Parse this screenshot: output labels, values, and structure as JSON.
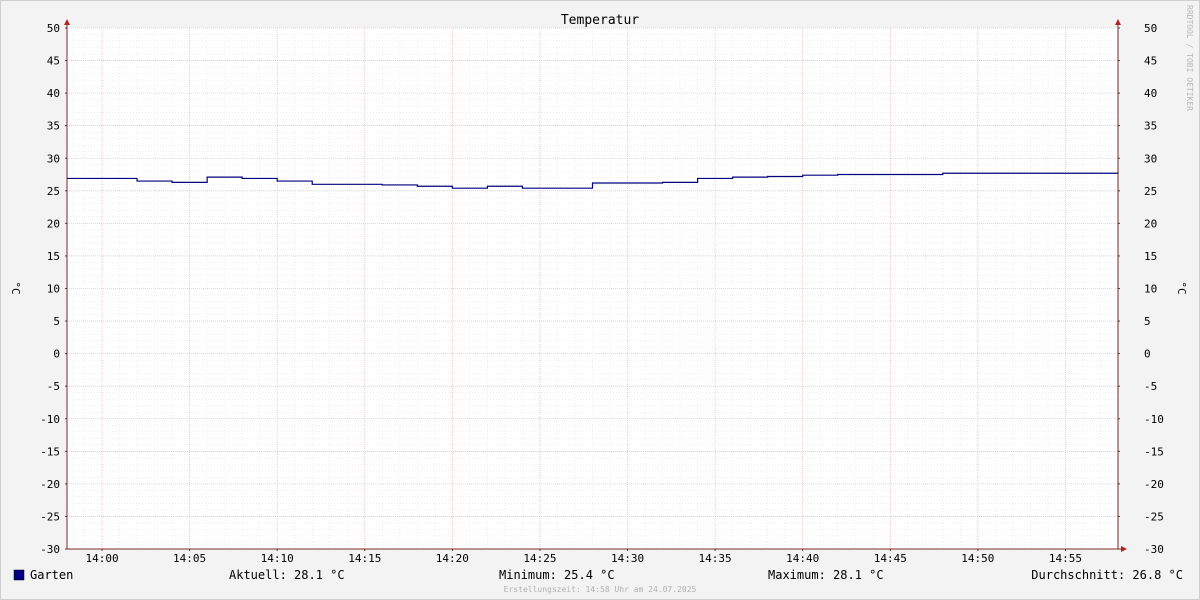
{
  "chart_data": {
    "type": "line",
    "title": "Temperatur",
    "ylabel": "°C",
    "ylabel_right": "°C",
    "ylim": [
      -30,
      50
    ],
    "xlim": [
      "13:58",
      "14:58"
    ],
    "grid": true,
    "y_ticks": [
      50,
      45,
      40,
      35,
      30,
      25,
      20,
      15,
      10,
      5,
      0,
      -5,
      -10,
      -15,
      -20,
      -25,
      -30
    ],
    "x_ticks": [
      "14:00",
      "14:05",
      "14:10",
      "14:15",
      "14:20",
      "14:25",
      "14:30",
      "14:35",
      "14:40",
      "14:45",
      "14:50",
      "14:55"
    ],
    "series": [
      {
        "name": "Garten",
        "color": "#000080",
        "x": [
          "13:58",
          "14:02",
          "14:04",
          "14:06",
          "14:08",
          "14:10",
          "14:12",
          "14:16",
          "14:18",
          "14:20",
          "14:22",
          "14:24",
          "14:28",
          "14:32",
          "14:34",
          "14:36",
          "14:38",
          "14:40",
          "14:42",
          "14:48",
          "14:58"
        ],
        "values": [
          26.9,
          26.5,
          26.3,
          27.1,
          26.9,
          26.5,
          26.0,
          25.9,
          25.7,
          25.4,
          25.7,
          25.4,
          26.2,
          26.3,
          26.9,
          27.1,
          27.2,
          27.4,
          27.5,
          27.7,
          28.0
        ]
      }
    ]
  },
  "legend": {
    "series_label": "Garten",
    "series_color": "#000080",
    "current": "Aktuell: 28.1 °C",
    "minimum": "Minimum: 25.4 °C",
    "maximum": "Maximum: 28.1 °C",
    "average": "Durchschnitt: 26.8 °C"
  },
  "footer": "Erstellungszeit: 14:58 Uhr am 24.07.2025",
  "watermark": "RRDTOOL / TOBI OETIKER",
  "colors": {
    "plot_bg": "#ffffff",
    "grid_minor": "#dcdcdc",
    "grid_major_x": "#f0b4b4",
    "axis": "#7a2a2a",
    "arrow": "#b22222"
  }
}
